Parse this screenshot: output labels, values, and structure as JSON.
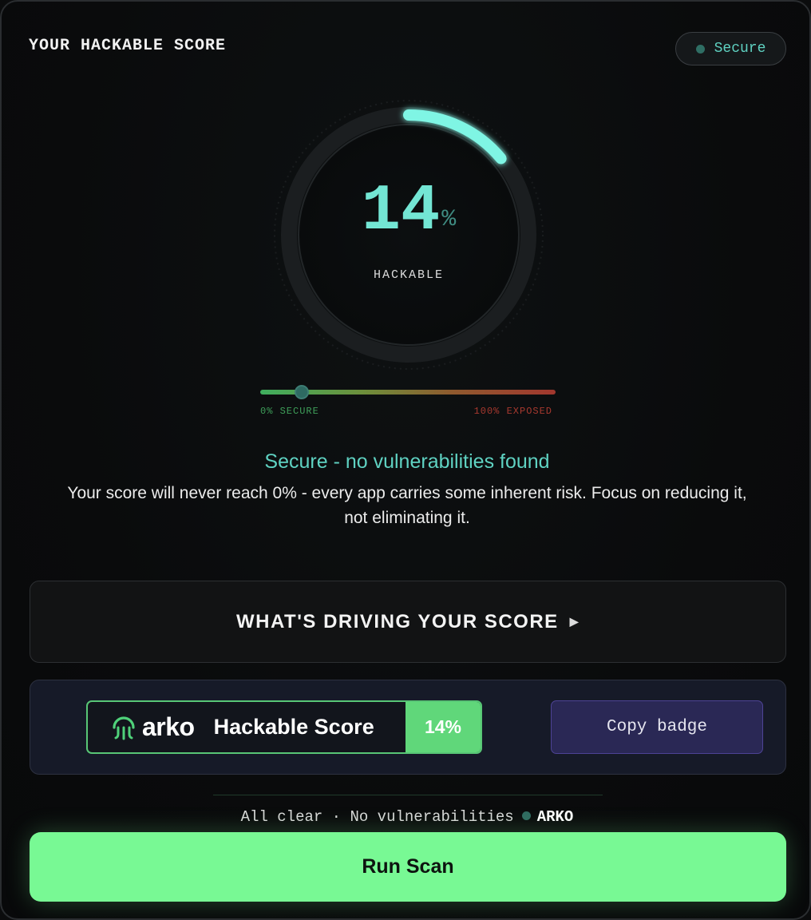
{
  "header": {
    "title": "YOUR HACKABLE SCORE",
    "status_label": "Secure"
  },
  "gauge": {
    "value": 14,
    "value_text": "14",
    "unit": "%",
    "label": "HACKABLE",
    "arc_color": "#7ff5e4"
  },
  "scale": {
    "min_label": "0% SECURE",
    "max_label": "100% EXPOSED",
    "marker_value_percent": 14
  },
  "summary": {
    "headline": "Secure - no vulnerabilities found",
    "description": "Your score will never reach 0% - every app carries some inherent risk. Focus on reducing it, not eliminating it."
  },
  "drivers": {
    "label": "WHAT'S DRIVING YOUR SCORE",
    "icon": "triangle-right-icon"
  },
  "badge": {
    "brand": "arko",
    "text": "Hackable Score",
    "score": "14%",
    "copy_label": "Copy badge",
    "accent": "#60d77a"
  },
  "footer": {
    "status_text": "All clear · No vulnerabilities",
    "brand": "ARKO"
  },
  "actions": {
    "run_label": "Run Scan"
  },
  "colors": {
    "accent": "#5fd2c2",
    "run_button": "#78f994",
    "copy_button": "#2a2855"
  }
}
